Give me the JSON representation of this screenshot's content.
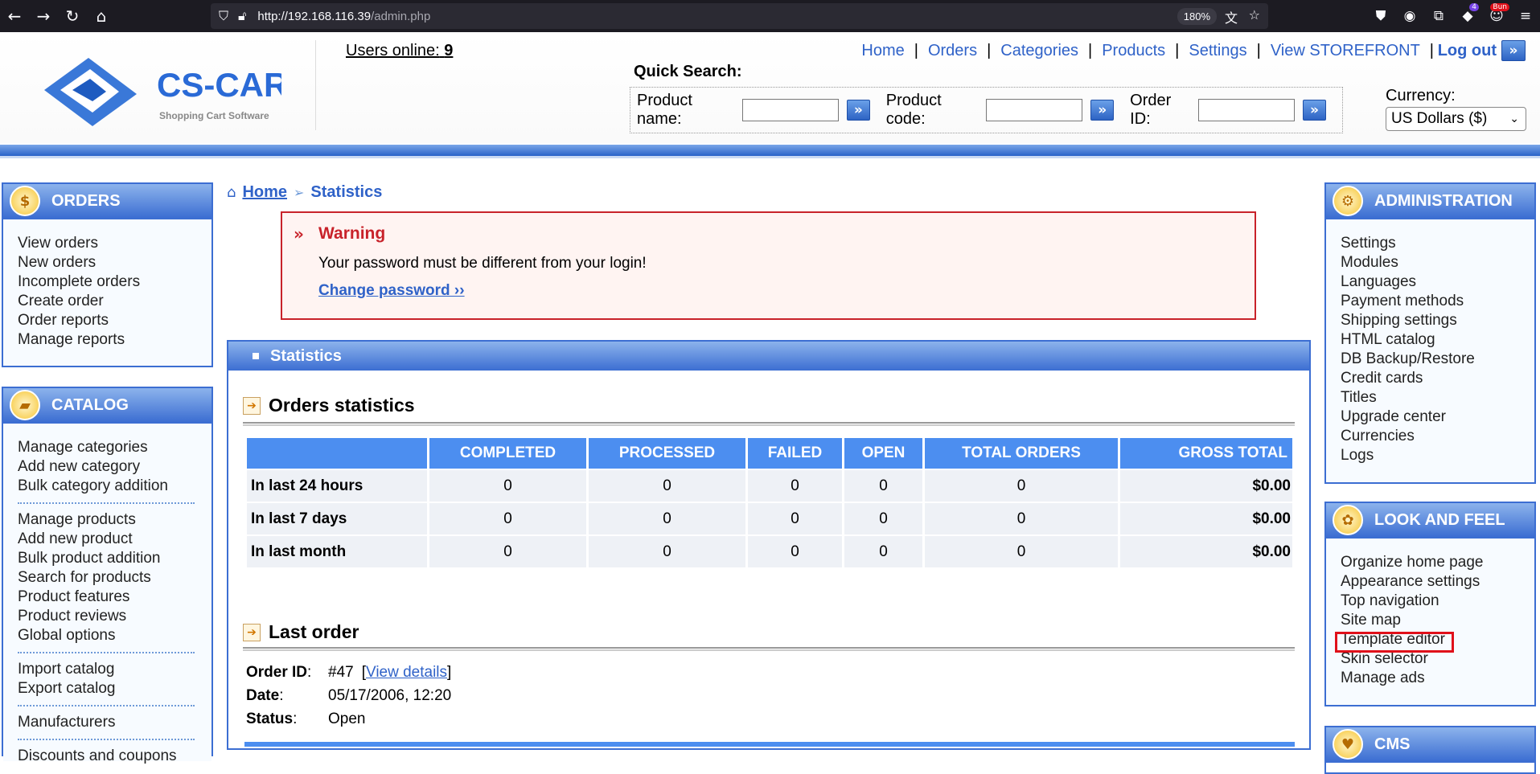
{
  "browser": {
    "url_host": "http://192.168.116.39",
    "url_path": "/admin.php",
    "zoom": "180%",
    "extension_badge": "4",
    "extension_label": "Bun"
  },
  "header": {
    "logo_text": "CS-CART",
    "logo_sub": "Shopping Cart Software",
    "users_online_label": "Users online:",
    "users_online_count": "9",
    "nav": [
      "Home",
      "Orders",
      "Categories",
      "Products",
      "Settings",
      "View STOREFRONT"
    ],
    "logout": "Log out",
    "quick_search_label": "Quick Search:",
    "product_name_label": "Product name:",
    "product_code_label": "Product code:",
    "order_id_label": "Order ID:",
    "currency_label": "Currency:",
    "currency_value": "US Dollars ($)"
  },
  "left": {
    "orders": {
      "title": "ORDERS",
      "items": [
        "View orders",
        "New orders",
        "Incomplete orders",
        "Create order",
        "Order reports",
        "Manage reports"
      ]
    },
    "catalog": {
      "title": "CATALOG",
      "group1": [
        "Manage categories",
        "Add new category",
        "Bulk category addition"
      ],
      "group2": [
        "Manage products",
        "Add new product",
        "Bulk product addition",
        "Search for products",
        "Product features",
        "Product reviews",
        "Global options"
      ],
      "group3": [
        "Import catalog",
        "Export catalog"
      ],
      "group4": [
        "Manufacturers"
      ],
      "group5": [
        "Discounts and coupons"
      ]
    }
  },
  "right": {
    "admin": {
      "title": "ADMINISTRATION",
      "items": [
        "Settings",
        "Modules",
        "Languages",
        "Payment methods",
        "Shipping settings",
        "HTML catalog",
        "DB Backup/Restore",
        "Credit cards",
        "Titles",
        "Upgrade center",
        "Currencies",
        "Logs"
      ]
    },
    "look": {
      "title": "LOOK AND FEEL",
      "items": [
        "Organize home page",
        "Appearance settings",
        "Top navigation",
        "Site map",
        "Template editor",
        "Skin selector",
        "Manage ads"
      ]
    },
    "cms": {
      "title": "CMS"
    }
  },
  "main": {
    "breadcrumb_home": "Home",
    "breadcrumb_current": "Statistics",
    "warning_title": "Warning",
    "warning_text": "Your password must be different from your login!",
    "warning_link": "Change password ››",
    "panel_title": "Statistics",
    "orders_stats_title": "Orders statistics",
    "columns": [
      "COMPLETED",
      "PROCESSED",
      "FAILED",
      "OPEN",
      "TOTAL ORDERS",
      "GROSS TOTAL"
    ],
    "rows": [
      {
        "label": "In last 24 hours",
        "values": [
          "0",
          "0",
          "0",
          "0",
          "0",
          "$0.00"
        ]
      },
      {
        "label": "In last 7 days",
        "values": [
          "0",
          "0",
          "0",
          "0",
          "0",
          "$0.00"
        ]
      },
      {
        "label": "In last month",
        "values": [
          "0",
          "0",
          "0",
          "0",
          "0",
          "$0.00"
        ]
      }
    ],
    "last_order_title": "Last order",
    "order_id_label": "Order ID",
    "order_id_value": "#47",
    "view_details": "View details",
    "date_label": "Date",
    "date_value": "05/17/2006, 12:20",
    "status_label": "Status",
    "status_value": "Open"
  }
}
